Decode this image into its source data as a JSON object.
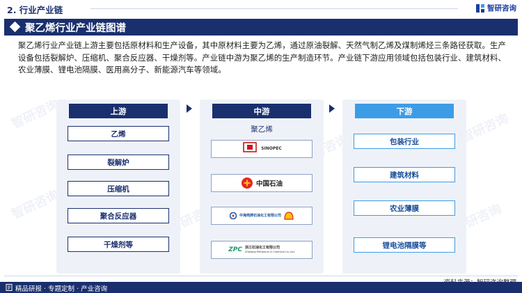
{
  "header": {
    "section_label": "2. 行业产业链",
    "brand": "智研咨询"
  },
  "title": "聚乙烯行业产业链图谱",
  "description": "聚乙烯行业产业链上游主要包括原材料和生产设备，其中原材料主要为乙烯，通过原油裂解、天然气制乙烯及煤制烯烃三条路径获取。生产设备包括裂解炉、压缩机、聚合反应器、干燥剂等。产业链中游为聚乙烯的生产制造环节。产业链下游应用领域包括包装行业、建筑材料、农业薄膜、锂电池隔膜、医用高分子、新能源汽车等领域。",
  "watermark": "智研咨询",
  "upstream": {
    "title": "上游",
    "items": [
      "乙烯",
      "裂解炉",
      "压缩机",
      "聚合反应器",
      "干燥剂等"
    ]
  },
  "midstream": {
    "title": "中游",
    "product": "聚乙烯",
    "logos": [
      {
        "name": "sinopec-logo",
        "text": "SINOPEC"
      },
      {
        "name": "petrochina-logo",
        "text": "中国石油"
      },
      {
        "name": "cnooc-shell-logo",
        "text": "中海壳牌石油化工有限公司"
      },
      {
        "name": "zpc-logo",
        "text": "浙江石油化工有限公司",
        "sub": "Zhejiang Petroleum & Chemical Co.,Ltd.",
        "mark": "ZPC"
      }
    ]
  },
  "downstream": {
    "title": "下游",
    "items": [
      "包装行业",
      "建筑材料",
      "农业薄膜",
      "锂电池隔膜等"
    ]
  },
  "footer": {
    "left": "精品研报 · 专题定制 · 产业咨询",
    "source": "资料来源：智研咨询整理"
  },
  "colors": {
    "navy": "#1a2f6e",
    "light_blue": "#3d9ce6",
    "panel": "#eef2f8"
  }
}
